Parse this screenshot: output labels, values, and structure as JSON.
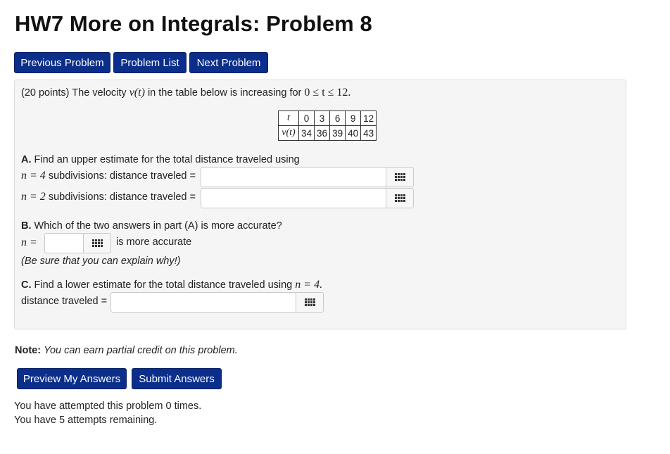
{
  "page": {
    "title": "HW7 More on Integrals: Problem 8"
  },
  "nav": {
    "previous": "Previous Problem",
    "list": "Problem List",
    "next": "Next Problem"
  },
  "problem": {
    "points": "(20 points)",
    "intro": "The velocity",
    "intro_mid": "in the table below is increasing for",
    "v_of_t": "v(t)",
    "range": "0 ≤ t ≤ 12.",
    "table": {
      "row1_header": "t",
      "row2_header": "v(t)",
      "t": [
        "0",
        "3",
        "6",
        "9",
        "12"
      ],
      "v": [
        "34",
        "36",
        "39",
        "40",
        "43"
      ]
    },
    "partA": {
      "label": "A.",
      "text": "Find an upper estimate for the total distance traveled using",
      "n4_math": "n = 4",
      "n4_text": "subdivisions: distance traveled =",
      "n4_value": "",
      "n2_math": "n = 2",
      "n2_text": "subdivisions: distance traveled =",
      "n2_value": ""
    },
    "partB": {
      "label": "B.",
      "text": "Which of the two answers in part (A) is more accurate?",
      "n_math": "n =",
      "n_value": "",
      "suffix": "is more accurate",
      "hint": "(Be sure that you can explain why!)"
    },
    "partC": {
      "label": "C.",
      "text": "Find a lower estimate for the total distance traveled using",
      "n_math": "n = 4.",
      "dist_label": "distance traveled =",
      "value": ""
    }
  },
  "note": {
    "label": "Note:",
    "text": "You can earn partial credit on this problem."
  },
  "actions": {
    "preview": "Preview My Answers",
    "submit": "Submit Answers"
  },
  "status": {
    "attempted": "You have attempted this problem 0 times.",
    "remaining": "You have 5 attempts remaining."
  }
}
